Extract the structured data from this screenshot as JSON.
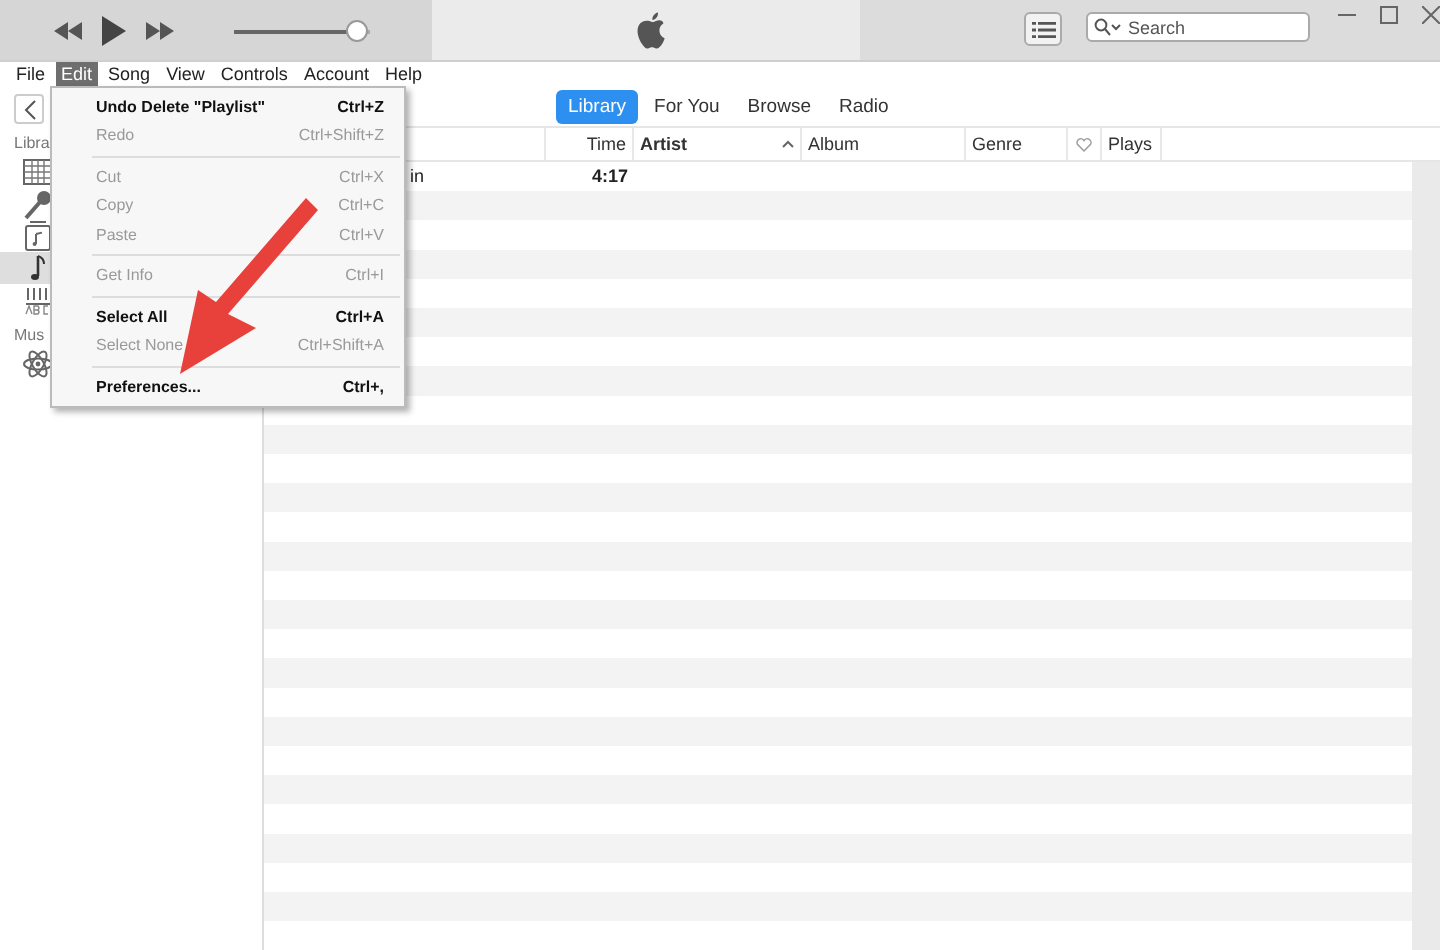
{
  "search": {
    "placeholder": "Search"
  },
  "volume": {
    "level": 0.9
  },
  "menu_bar": [
    {
      "label": "File",
      "selected": false
    },
    {
      "label": "Edit",
      "selected": true
    },
    {
      "label": "Song",
      "selected": false
    },
    {
      "label": "View",
      "selected": false
    },
    {
      "label": "Controls",
      "selected": false
    },
    {
      "label": "Account",
      "selected": false
    },
    {
      "label": "Help",
      "selected": false
    }
  ],
  "edit_menu": [
    {
      "kind": "item",
      "label": "Undo Delete \"Playlist\"",
      "shortcut": "Ctrl+Z",
      "disabled": false
    },
    {
      "kind": "item",
      "label": "Redo",
      "shortcut": "Ctrl+Shift+Z",
      "disabled": true
    },
    {
      "kind": "separator"
    },
    {
      "kind": "item",
      "label": "Cut",
      "shortcut": "Ctrl+X",
      "disabled": true
    },
    {
      "kind": "item",
      "label": "Copy",
      "shortcut": "Ctrl+C",
      "disabled": true
    },
    {
      "kind": "item",
      "label": "Paste",
      "shortcut": "Ctrl+V",
      "disabled": true
    },
    {
      "kind": "separator"
    },
    {
      "kind": "item",
      "label": "Get Info",
      "shortcut": "Ctrl+I",
      "disabled": true
    },
    {
      "kind": "separator"
    },
    {
      "kind": "item",
      "label": "Select All",
      "shortcut": "Ctrl+A",
      "disabled": false
    },
    {
      "kind": "item",
      "label": "Select None",
      "shortcut": "Ctrl+Shift+A",
      "disabled": true
    },
    {
      "kind": "separator"
    },
    {
      "kind": "item",
      "label": "Preferences...",
      "shortcut": "Ctrl+,",
      "disabled": false
    }
  ],
  "tabs": [
    {
      "label": "Library",
      "selected": true
    },
    {
      "label": "For You",
      "selected": false
    },
    {
      "label": "Browse",
      "selected": false
    },
    {
      "label": "Radio",
      "selected": false
    }
  ],
  "sidebar": {
    "sections": [
      {
        "heading": "Libra",
        "items": [
          {
            "kind": "grid",
            "selected": false
          },
          {
            "kind": "mic",
            "selected": false
          },
          {
            "kind": "video",
            "selected": false
          },
          {
            "kind": "note",
            "selected": true
          },
          {
            "kind": "abc",
            "selected": false
          }
        ]
      },
      {
        "heading": "Mus",
        "items": [
          {
            "kind": "atom",
            "selected": false
          }
        ]
      }
    ]
  },
  "table": {
    "columns": [
      {
        "label": "Time",
        "kind": "text"
      },
      {
        "label": "Artist",
        "kind": "sorted"
      },
      {
        "label": "Album",
        "kind": "text"
      },
      {
        "label": "Genre",
        "kind": "text"
      },
      {
        "kind": "heart"
      },
      {
        "label": "Plays",
        "kind": "text"
      }
    ],
    "rows": [
      {
        "name": "in",
        "time": "4:17"
      }
    ]
  }
}
